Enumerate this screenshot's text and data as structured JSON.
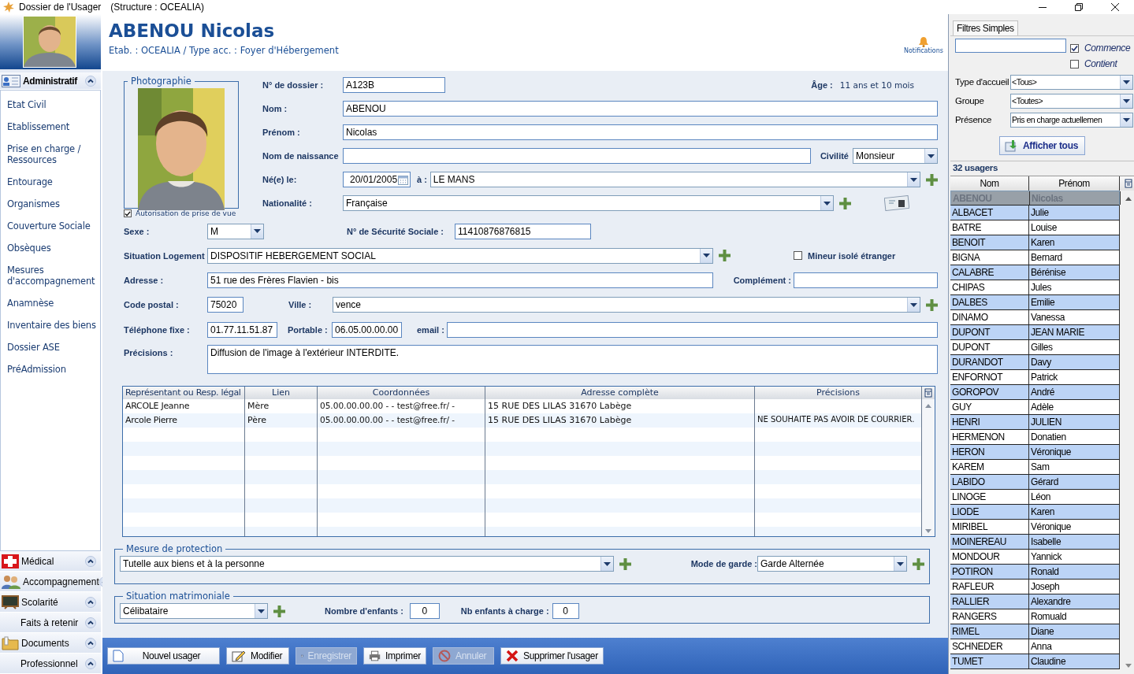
{
  "window": {
    "title": "Dossier de l'Usager",
    "subtitle": "(Structure : OCEALIA)"
  },
  "sidebar": {
    "sections": [
      {
        "label": "Administratif",
        "kind": "idcard",
        "expanded": true,
        "items": [
          "Etat Civil",
          "Etablissement",
          "Prise en charge / Ressources",
          "Entourage",
          "Organismes",
          "Couverture Sociale",
          "Obsèques",
          "Mesures d'accompagnement",
          "Anamnèse",
          "Inventaire des biens",
          "Dossier ASE",
          "PréAdmission"
        ]
      },
      {
        "label": "Médical",
        "kind": "medical",
        "expanded": false
      },
      {
        "label": "Accompagnement",
        "kind": "people",
        "expanded": false
      },
      {
        "label": "Scolarité",
        "kind": "board",
        "expanded": false
      },
      {
        "label": "Faits à retenir",
        "kind": "none",
        "expanded": false
      },
      {
        "label": "Documents",
        "kind": "folder",
        "expanded": false
      },
      {
        "label": "Professionnel",
        "kind": "none",
        "expanded": false
      }
    ]
  },
  "header": {
    "name": "ABENOU Nicolas",
    "info": "Etab. : OCEALIA / Type acc. : Foyer d'Hébergement",
    "notifications": "Notifications"
  },
  "photo": {
    "legend": "Photographie",
    "consent": {
      "label": "Autorisation de prise de vue",
      "checked": true
    }
  },
  "identity": {
    "dossier": {
      "label": "N° de dossier :",
      "value": "A123B"
    },
    "age": {
      "label": "Âge :",
      "value": "11 ans et 10 mois"
    },
    "nom": {
      "label": "Nom :",
      "value": "ABENOU"
    },
    "prenom": {
      "label": "Prénom :",
      "value": "Nicolas"
    },
    "nom_naissance": {
      "label": "Nom de naissance"
    },
    "civilite": {
      "label": "Civilité",
      "value": "Monsieur"
    },
    "naissance": {
      "label": "Né(e) le:",
      "value": "20/01/2005"
    },
    "lieu": {
      "label": "à :",
      "value": "LE MANS"
    },
    "nationalite": {
      "label": "Nationalité :",
      "value": "Française"
    },
    "sexe": {
      "label": "Sexe :",
      "value": "M"
    },
    "secu": {
      "label": "N° de Sécurité Sociale :",
      "value": "11410876876815"
    },
    "logement": {
      "label": "Situation Logement",
      "value": "DISPOSITIF HEBERGEMENT SOCIAL"
    },
    "mineur": {
      "label": "Mineur isolé étranger",
      "checked": false
    },
    "adresse": {
      "label": "Adresse :",
      "value": "51 rue des Frères Flavien - bis"
    },
    "complement": {
      "label": "Complément :"
    },
    "cp": {
      "label": "Code postal :",
      "value": "75020"
    },
    "ville": {
      "label": "Ville :",
      "value": "vence"
    },
    "tel": {
      "label": "Téléphone fixe :",
      "value": "01.77.11.51.87"
    },
    "portable": {
      "label": "Portable :",
      "value": "06.05.00.00.00"
    },
    "email": {
      "label": "email :"
    },
    "precisions": {
      "label": "Précisions :",
      "value": "Diffusion de l'image à l'extérieur INTERDITE."
    }
  },
  "representants": {
    "columns": [
      "Représentant ou Resp. légal",
      "Lien",
      "Coordonnées",
      "Adresse complète",
      "Précisions"
    ],
    "rows": [
      {
        "cells": [
          "ARCOLE Jeanne",
          "Mère",
          "05.00.00.00.00 -  - test@free.fr/ -",
          "15 RUE DES LILAS  31670 Labège",
          ""
        ]
      },
      {
        "cells": [
          "Arcole Pierre",
          "Père",
          "05.00.00.00.00 -  - test@free.fr/ -",
          "15 RUE DES LILAS  31670 Labège",
          "NE SOUHAITE PAS AVOIR DE COURRIER."
        ]
      }
    ]
  },
  "protection": {
    "legend": "Mesure de protection",
    "mesure": "Tutelle aux biens et à la personne",
    "garde_label": "Mode de garde :",
    "garde": "Garde Alternée"
  },
  "matrimoniale": {
    "legend": "Situation matrimoniale",
    "situation": "Célibataire",
    "enfants_label": "Nombre d'enfants :",
    "enfants": "0",
    "charge_label": "Nb enfants à charge :",
    "charge": "0"
  },
  "toolbar": [
    {
      "label": "Nouvel usager",
      "kind": "new",
      "disabled": false
    },
    {
      "label": "Modifier",
      "kind": "edit",
      "disabled": false
    },
    {
      "label": "Enregistrer",
      "kind": "save",
      "disabled": true
    },
    {
      "label": "Imprimer",
      "kind": "print",
      "disabled": false
    },
    {
      "label": "Annuler",
      "kind": "cancel",
      "disabled": true
    },
    {
      "label": "Supprimer l'usager",
      "kind": "delete",
      "disabled": false
    }
  ],
  "filters": {
    "tab": "Filtres Simples",
    "commence": {
      "label": "Commence",
      "checked": true
    },
    "contient": {
      "label": "Contient",
      "checked": false
    },
    "selects": [
      {
        "label": "Type d'accueil",
        "value": "<Tous>"
      },
      {
        "label": "Groupe",
        "value": "<Toutes>"
      },
      {
        "label": "Présence",
        "value": "Pris en charge actuellemen"
      }
    ],
    "button": "Afficher tous"
  },
  "usagers": {
    "count": "32 usagers",
    "columns": [
      "Nom",
      "Prénom"
    ],
    "rows": [
      {
        "nom": "ABENOU",
        "prenom": "Nicolas",
        "selected": true
      },
      {
        "nom": "ALBACET",
        "prenom": "Julie",
        "selected": false
      },
      {
        "nom": "BATRE",
        "prenom": "Louise",
        "selected": false
      },
      {
        "nom": "BENOIT",
        "prenom": "Karen",
        "selected": false
      },
      {
        "nom": "BIGNA",
        "prenom": "Bernard",
        "selected": false
      },
      {
        "nom": "CALABRE",
        "prenom": "Bérénise",
        "selected": false
      },
      {
        "nom": "CHIPAS",
        "prenom": "Jules",
        "selected": false
      },
      {
        "nom": "DALBES",
        "prenom": "Emilie",
        "selected": false
      },
      {
        "nom": "DINAMO",
        "prenom": "Vanessa",
        "selected": false
      },
      {
        "nom": "DUPONT",
        "prenom": "JEAN MARIE",
        "selected": false
      },
      {
        "nom": "DUPONT",
        "prenom": "Gilles",
        "selected": false
      },
      {
        "nom": "DURANDOT",
        "prenom": "Davy",
        "selected": false
      },
      {
        "nom": "ENFORNOT",
        "prenom": "Patrick",
        "selected": false
      },
      {
        "nom": "GOROPOV",
        "prenom": "André",
        "selected": false
      },
      {
        "nom": "GUY",
        "prenom": "Adèle",
        "selected": false
      },
      {
        "nom": "HENRI",
        "prenom": "JULIEN",
        "selected": false
      },
      {
        "nom": "HERMENON",
        "prenom": "Donatien",
        "selected": false
      },
      {
        "nom": "HERON",
        "prenom": "Véronique",
        "selected": false
      },
      {
        "nom": "KAREM",
        "prenom": "Sam",
        "selected": false
      },
      {
        "nom": "LABIDO",
        "prenom": "Gérard",
        "selected": false
      },
      {
        "nom": "LINOGE",
        "prenom": "Léon",
        "selected": false
      },
      {
        "nom": "LIODE",
        "prenom": "Karen",
        "selected": false
      },
      {
        "nom": "MIRIBEL",
        "prenom": "Véronique",
        "selected": false
      },
      {
        "nom": "MOINEREAU",
        "prenom": "Isabelle",
        "selected": false
      },
      {
        "nom": "MONDOUR",
        "prenom": "Yannick",
        "selected": false
      },
      {
        "nom": "POTIRON",
        "prenom": "Ronald",
        "selected": false
      },
      {
        "nom": "RAFLEUR",
        "prenom": "Joseph",
        "selected": false
      },
      {
        "nom": "RALLIER",
        "prenom": "Alexandre",
        "selected": false
      },
      {
        "nom": "RANGERS",
        "prenom": "Romuald",
        "selected": false
      },
      {
        "nom": "RIMEL",
        "prenom": "Diane",
        "selected": false
      },
      {
        "nom": "SCHNEDER",
        "prenom": "Anna",
        "selected": false
      },
      {
        "nom": "TUMET",
        "prenom": "Claudine",
        "selected": false
      }
    ]
  }
}
